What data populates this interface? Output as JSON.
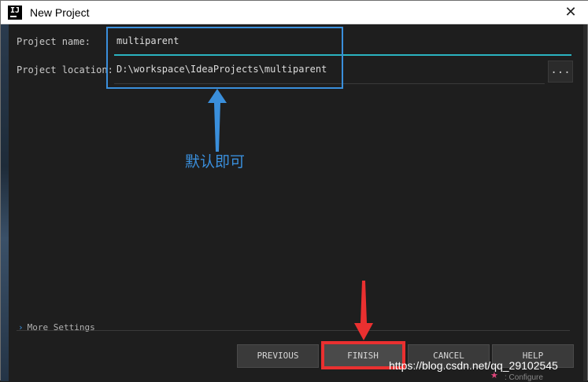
{
  "window": {
    "title": "New Project",
    "app_icon_label": "IJ",
    "close_glyph": "✕"
  },
  "form": {
    "project_name_label": "Project name:",
    "project_name_value": "multiparent",
    "project_location_label": "Project location:",
    "project_location_value": "D:\\workspace\\IdeaProjects\\multiparent",
    "browse_label": "..."
  },
  "annotation": {
    "text": "默认即可",
    "blue_color": "#3a8fdc",
    "red_color": "#ea3030"
  },
  "more_settings": {
    "label": "More Settings",
    "chevron": "›"
  },
  "buttons": {
    "previous": "PREVIOUS",
    "finish": "FINISH",
    "cancel": "CANCEL",
    "help": "HELP"
  },
  "footer": {
    "watermark": "https://blog.csdn.net/qq_29102545",
    "bottom_snippet": ": Configure"
  },
  "colors": {
    "focus_underline": "#2bb3c0",
    "background": "#1e1e1e"
  }
}
